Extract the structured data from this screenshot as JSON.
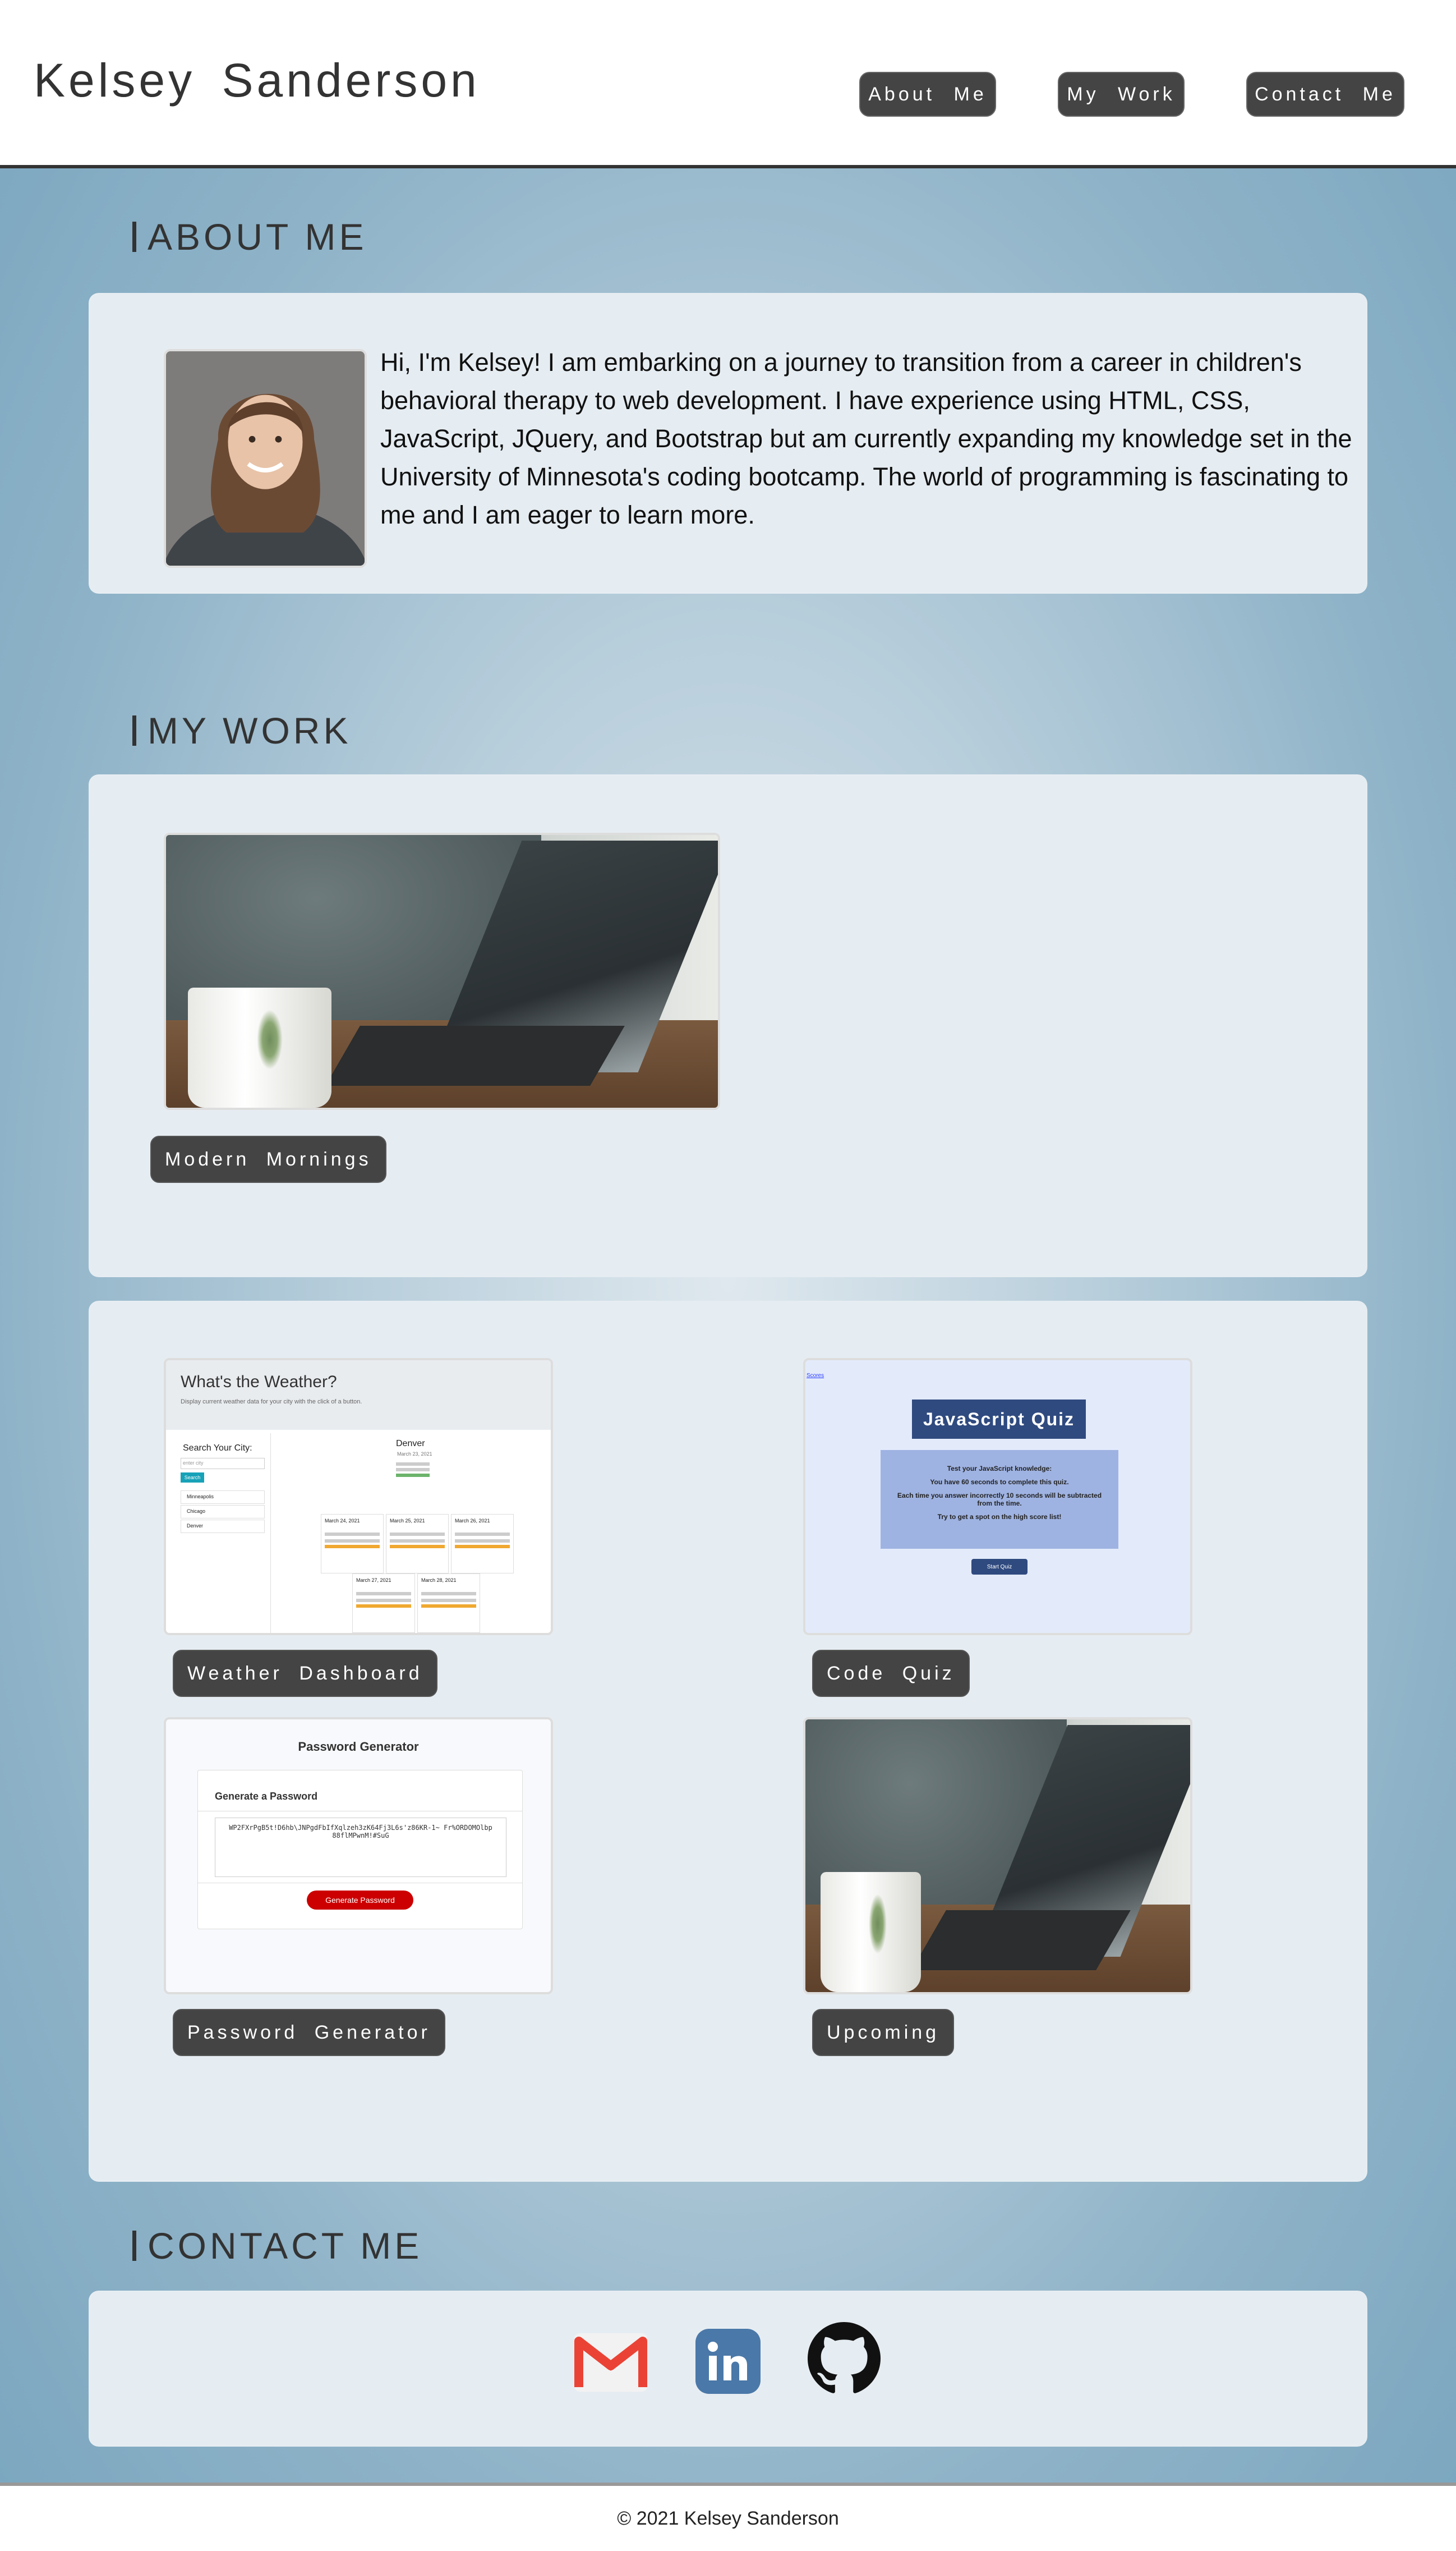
{
  "header": {
    "brand": "Kelsey Sanderson",
    "nav": {
      "about": "About Me",
      "work": "My Work",
      "contact": "Contact Me"
    }
  },
  "about": {
    "title": "ABOUT ME",
    "bio": "Hi, I'm Kelsey! I am embarking on a journey to transition from a career in children's behavioral therapy to web development. I have experience using HTML, CSS, JavaScript, JQuery, and Bootstrap but am currently expanding my knowledge set in the University of Minnesota's coding bootcamp. The world of programming is fascinating to me and I am eager to learn more."
  },
  "work": {
    "title": "MY WORK",
    "featured": {
      "label": "Modern Mornings"
    },
    "projects": [
      {
        "label": "Weather Dashboard"
      },
      {
        "label": "Code Quiz"
      },
      {
        "label": "Password Generator"
      },
      {
        "label": "Upcoming"
      }
    ],
    "weather_preview": {
      "heading": "What's the Weather?",
      "sub": "Display current weather data for your city with the click of a button.",
      "search_label": "Search Your City:",
      "search_placeholder": "enter city",
      "search_btn": "Search",
      "cities": [
        "Minneapolis",
        "Chicago",
        "Denver"
      ],
      "current_city": "Denver",
      "current_date": "March 23, 2021",
      "forecast_dates": [
        "March 24, 2021",
        "March 25, 2021",
        "March 26, 2021",
        "March 27, 2021",
        "March 28, 2021"
      ]
    },
    "quiz_preview": {
      "link": "Scores",
      "title": "JavaScript Quiz",
      "lines": [
        "Test your JavaScript knowledge:",
        "You have 60 seconds to complete this quiz.",
        "Each time you answer incorrectly 10 seconds will be subtracted from the time.",
        "Try to get a spot on the high score list!"
      ],
      "start": "Start Quiz"
    },
    "password_preview": {
      "title": "Password Generator",
      "card_title": "Generate a Password",
      "password": "WP2FXrPgB5t!D6hb\\JNPgdFbIfXqlzeh3zK64Fj3L6s'z86KR-1~ Fr%ORDOMOlbp88flMPwnM!#SuG",
      "button": "Generate Password"
    }
  },
  "contact": {
    "title": "CONTACT ME",
    "icons": [
      "gmail-icon",
      "linkedin-icon",
      "github-icon"
    ],
    "colors": {
      "gmail_red": "#EA4335",
      "linkedin_blue": "#4a78a8",
      "github_black": "#111111"
    }
  },
  "footer": {
    "text": "© 2021 Kelsey Sanderson"
  }
}
